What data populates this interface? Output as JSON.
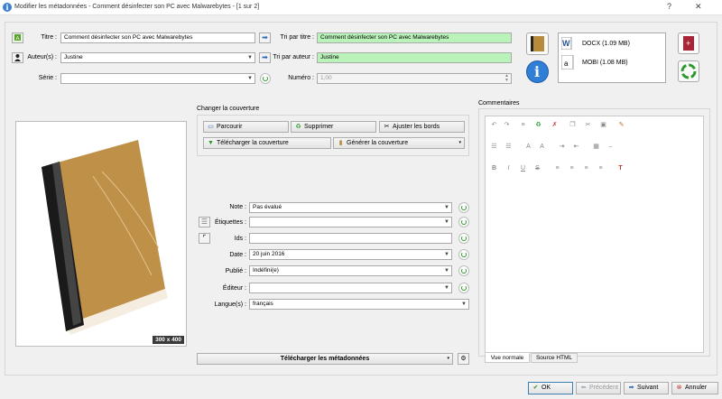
{
  "window": {
    "title": "Modifier les métadonnées - Comment désinfecter son PC avec Malwarebytes - [1 sur 2]",
    "help": "?",
    "close": "✕"
  },
  "fields": {
    "titre_label": "Titre :",
    "titre_value": "Comment désinfecter son PC avec Malwarebytes",
    "auteurs_label": "Auteur(s) :",
    "auteurs_value": "Justine",
    "serie_label": "Série :",
    "serie_value": "",
    "tri_titre_label": "Tri par titre :",
    "tri_titre_value": "Comment désinfecter son PC avec Malwarebytes",
    "tri_auteur_label": "Tri par auteur :",
    "tri_auteur_value": "Justine",
    "numero_label": "Numéro :",
    "numero_value": "1,00"
  },
  "formats": [
    {
      "label": "DOCX (1.09 MB)",
      "icon": "word-doc-icon"
    },
    {
      "label": "MOBI (1.08 MB)",
      "icon": "mobi-file-icon"
    }
  ],
  "cover": {
    "group_title": "Changer la couverture",
    "parcourir": "Parcourir",
    "supprimer": "Supprimer",
    "ajuster": "Ajuster les bords",
    "telecharger": "Télécharger la couverture",
    "generer": "Générer la couverture",
    "size_badge": "300 x 400"
  },
  "meta": {
    "note_label": "Note :",
    "note_value": "Pas évalué",
    "etiquettes_label": "Étiquettes :",
    "etiquettes_value": "",
    "ids_label": "Ids :",
    "ids_value": "",
    "date_label": "Date :",
    "date_value": "20 juin 2016",
    "publie_label": "Publié :",
    "publie_value": "Indéfini(e)",
    "editeur_label": "Éditeur :",
    "editeur_value": "",
    "langue_label": "Langue(s) :",
    "langue_value": "français",
    "download_meta": "Télécharger les métadonnées"
  },
  "comments": {
    "title": "Commentaires",
    "tab_normal": "Vue normale",
    "tab_html": "Source HTML"
  },
  "footer": {
    "ok": "OK",
    "precedent": "Précédent",
    "suivant": "Suivant",
    "annuler": "Annuler"
  },
  "colors": {
    "green_field": "#b9f3b9",
    "accent": "#3b7fd0"
  }
}
